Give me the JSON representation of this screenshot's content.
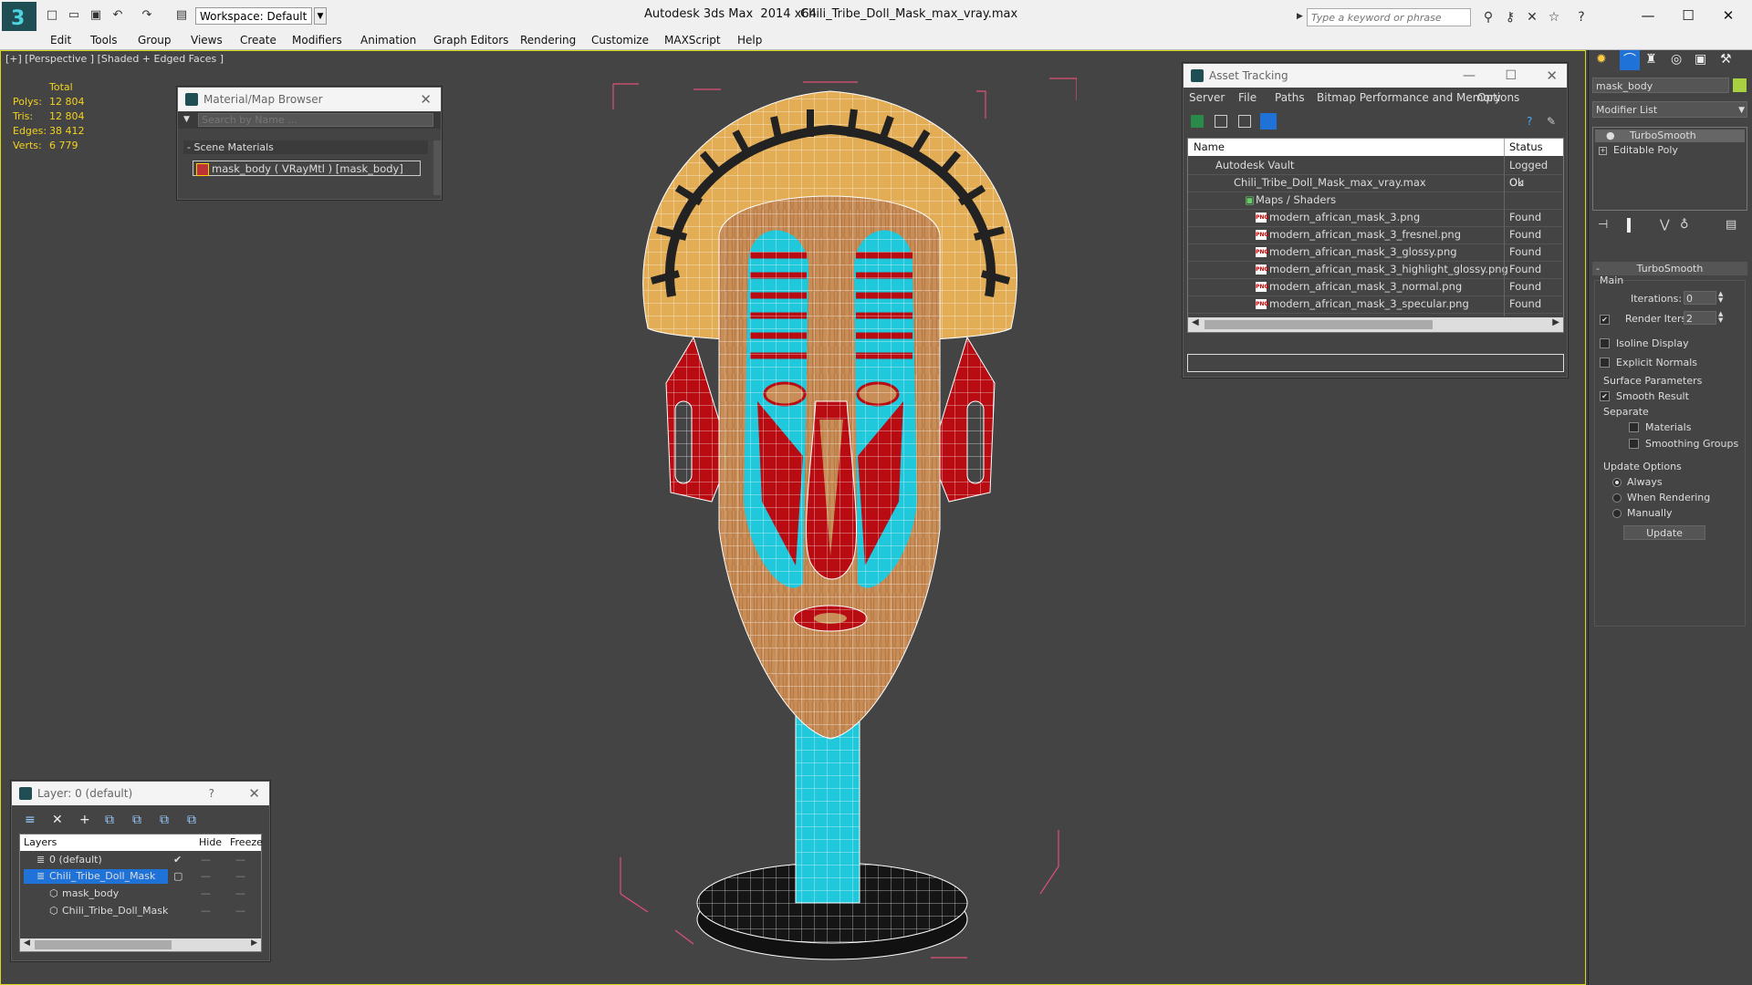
{
  "titlebar": {
    "app_name": "Autodesk 3ds Max  2014 x64",
    "file_name": "Chili_Tribe_Doll_Mask_max_vray.max",
    "workspace": "Workspace: Default",
    "search_placeholder": "Type a keyword or phrase"
  },
  "menu": [
    "Edit",
    "Tools",
    "Group",
    "Views",
    "Create",
    "Modifiers",
    "Animation",
    "Graph Editors",
    "Rendering",
    "Customize",
    "MAXScript",
    "Help"
  ],
  "viewport": {
    "label": "[+] [Perspective ] [Shaded + Edged Faces ]",
    "stats": {
      "header": "Total",
      "rows": [
        {
          "label": "Polys:",
          "value": "12 804"
        },
        {
          "label": "Tris:",
          "value": "12 804"
        },
        {
          "label": "Edges:",
          "value": "38 412"
        },
        {
          "label": "Verts:",
          "value": "6 779"
        }
      ]
    }
  },
  "material_browser": {
    "title": "Material/Map Browser",
    "search_placeholder": "Search by Name ...",
    "section": "- Scene Materials",
    "material": "mask_body  ( VRayMtl ) [mask_body]"
  },
  "asset_tracking": {
    "title": "Asset Tracking",
    "menu": [
      "Server",
      "File",
      "Paths",
      "Bitmap Performance and Memory",
      "Options"
    ],
    "col_name": "Name",
    "col_status": "Status",
    "rows": [
      {
        "name": "Autodesk Vault",
        "status": "Logged Ou",
        "indent": 0
      },
      {
        "name": "Chili_Tribe_Doll_Mask_max_vray.max",
        "status": "Ok",
        "indent": 1
      },
      {
        "name": "Maps / Shaders",
        "status": "",
        "indent": 2
      },
      {
        "name": "modern_african_mask_3.png",
        "status": "Found",
        "indent": 3
      },
      {
        "name": "modern_african_mask_3_fresnel.png",
        "status": "Found",
        "indent": 3
      },
      {
        "name": "modern_african_mask_3_glossy.png",
        "status": "Found",
        "indent": 3
      },
      {
        "name": "modern_african_mask_3_highlight_glossy.png",
        "status": "Found",
        "indent": 3
      },
      {
        "name": "modern_african_mask_3_normal.png",
        "status": "Found",
        "indent": 3
      },
      {
        "name": "modern_african_mask_3_specular.png",
        "status": "Found",
        "indent": 3
      }
    ]
  },
  "layer_panel": {
    "title": "Layer: 0 (default)",
    "help": "?",
    "col_layers": "Layers",
    "col_hide": "Hide",
    "col_freeze": "Freeze",
    "rows": [
      {
        "name": "0 (default)"
      },
      {
        "name": "Chili_Tribe_Doll_Mask"
      },
      {
        "name": "mask_body"
      },
      {
        "name": "Chili_Tribe_Doll_Mask"
      }
    ]
  },
  "command_panel": {
    "object_name": "mask_body",
    "modifier_list": "Modifier List",
    "stack": [
      "TurboSmooth",
      "Editable Poly"
    ],
    "rollout_title": "TurboSmooth",
    "main": "Main",
    "iterations_label": "Iterations:",
    "iterations_value": "0",
    "render_iters_label": "Render Iters:",
    "render_iters_value": "2",
    "isoline": "Isoline Display",
    "explicit_normals": "Explicit Normals",
    "surface_params": "Surface Parameters",
    "smooth_result": "Smooth Result",
    "separate": "Separate",
    "materials": "Materials",
    "smoothing_groups": "Smoothing Groups",
    "update_options": "Update Options",
    "always": "Always",
    "when_rendering": "When Rendering",
    "manually": "Manually",
    "update_button": "Update"
  },
  "colors": {
    "accent_yellow": "#f2d21f",
    "mask_wood": "#c98e58",
    "mask_cyan": "#20c8dc",
    "mask_red": "#b80c12",
    "mask_tan": "#e3ad55",
    "selection_blue": "#1e72d8"
  }
}
